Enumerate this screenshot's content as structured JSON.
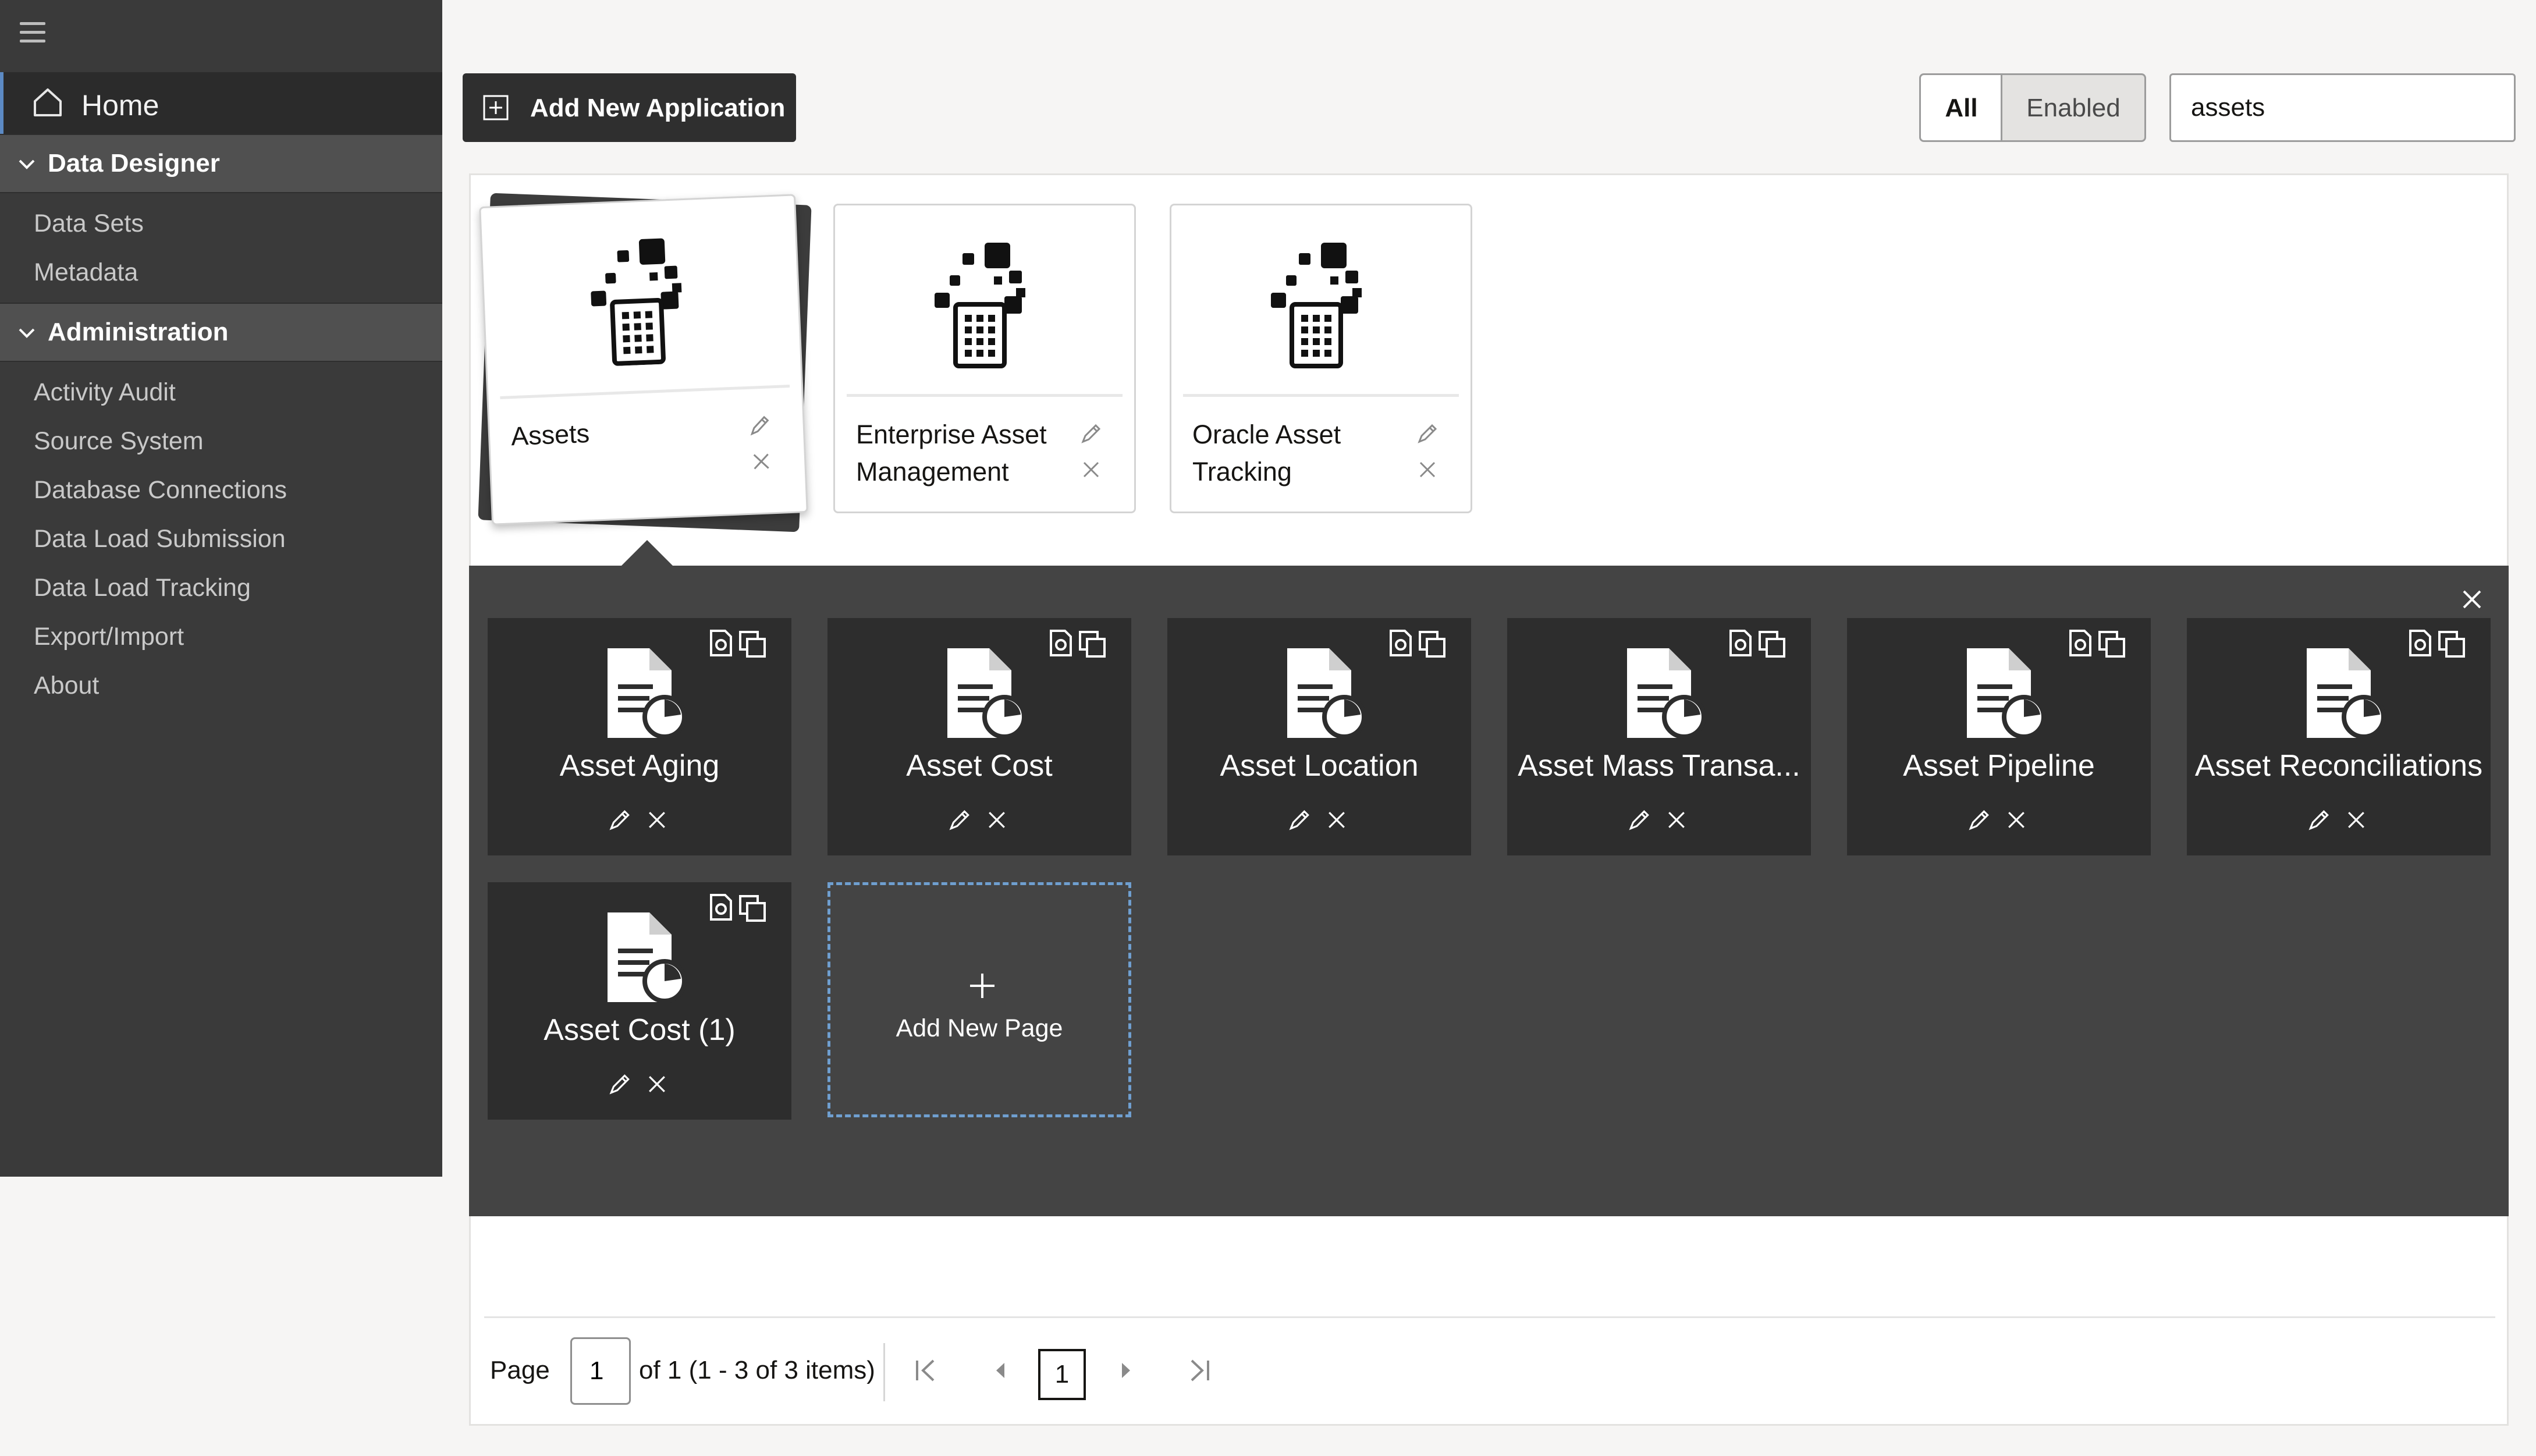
{
  "sidebar": {
    "home_label": "Home",
    "sections": [
      {
        "label": "Data Designer",
        "items": [
          "Data Sets",
          "Metadata"
        ]
      },
      {
        "label": "Administration",
        "items": [
          "Activity Audit",
          "Source System",
          "Database Connections",
          "Data Load Submission",
          "Data Load Tracking",
          "Export/Import",
          "About"
        ]
      }
    ]
  },
  "toolbar": {
    "add_app_label": "Add New Application",
    "filter": {
      "all": "All",
      "enabled": "Enabled",
      "selected": "All"
    },
    "search_value": "assets"
  },
  "applications": [
    {
      "name": "Assets",
      "selected": true
    },
    {
      "name": "Enterprise Asset Management",
      "selected": false
    },
    {
      "name": "Oracle Asset Tracking",
      "selected": false
    }
  ],
  "pages": [
    {
      "title": "Asset Aging"
    },
    {
      "title": "Asset Cost"
    },
    {
      "title": "Asset Location"
    },
    {
      "title": "Asset Mass Transa..."
    },
    {
      "title": "Asset Pipeline"
    },
    {
      "title": "Asset Reconciliations"
    },
    {
      "title": "Asset Cost (1)"
    }
  ],
  "add_page_label": "Add New Page",
  "pagination": {
    "page_label": "Page",
    "page_value": "1",
    "info": "of 1 (1 - 3 of 3 items)",
    "current_page": "1"
  },
  "colors": {
    "sidebar_bg": "#3a3a3a",
    "dark_panel": "#444444",
    "tile_bg": "#2d2d2d",
    "add_page_border": "#6f9fd0"
  }
}
